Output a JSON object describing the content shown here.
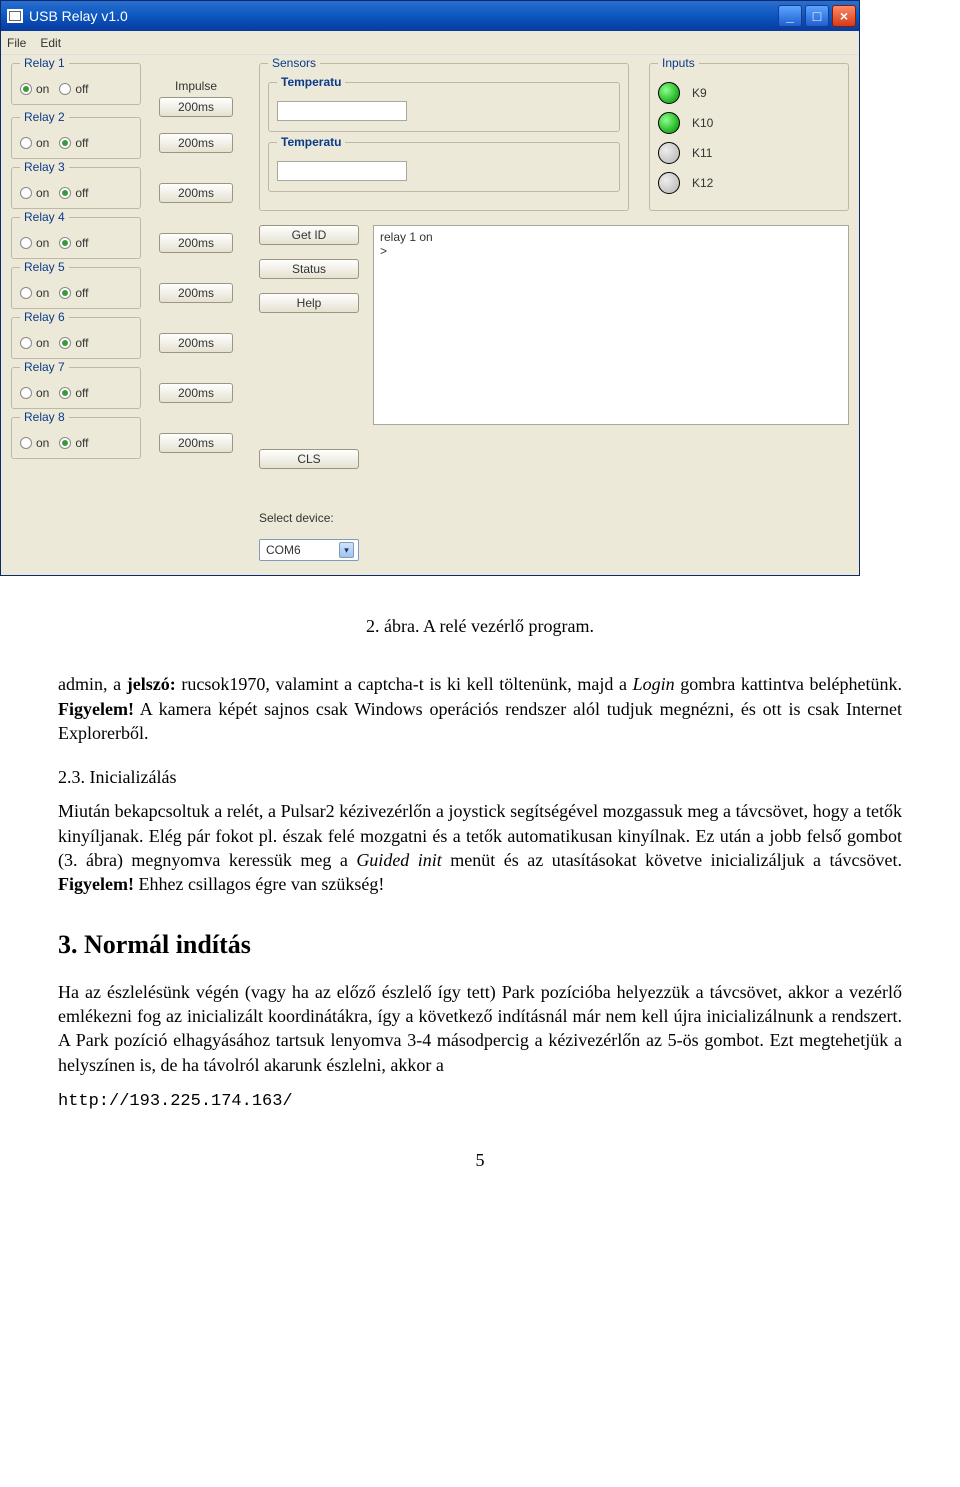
{
  "window": {
    "title": "USB Relay  v1.0",
    "menus": [
      "File",
      "Edit"
    ],
    "win_buttons": {
      "min": "_",
      "max": "□",
      "close": "×"
    }
  },
  "relays": [
    {
      "name": "Relay 1",
      "on": true,
      "off": false,
      "impulse": "200ms"
    },
    {
      "name": "Relay 2",
      "on": false,
      "off": true,
      "impulse": "200ms"
    },
    {
      "name": "Relay 3",
      "on": false,
      "off": true,
      "impulse": "200ms"
    },
    {
      "name": "Relay 4",
      "on": false,
      "off": true,
      "impulse": "200ms"
    },
    {
      "name": "Relay 5",
      "on": false,
      "off": true,
      "impulse": "200ms"
    },
    {
      "name": "Relay 6",
      "on": false,
      "off": true,
      "impulse": "200ms"
    },
    {
      "name": "Relay 7",
      "on": false,
      "off": true,
      "impulse": "200ms"
    },
    {
      "name": "Relay 8",
      "on": false,
      "off": true,
      "impulse": "200ms"
    }
  ],
  "impulse_header": "Impulse",
  "radio_labels": {
    "on": "on",
    "off": "off"
  },
  "sensors": {
    "legend": "Sensors",
    "items": [
      {
        "title": "Temperatu",
        "value": ""
      },
      {
        "title": "Temperatu",
        "value": ""
      }
    ]
  },
  "inputs": {
    "legend": "Inputs",
    "items": [
      {
        "label": "K9",
        "on": true
      },
      {
        "label": "K10",
        "on": true
      },
      {
        "label": "K11",
        "on": false
      },
      {
        "label": "K12",
        "on": false
      }
    ]
  },
  "mid_buttons": {
    "get_id": "Get ID",
    "status": "Status",
    "help": "Help",
    "cls": "CLS"
  },
  "textarea": "relay 1 on\n>",
  "select": {
    "label": "Select device:",
    "value": "COM6"
  },
  "doc": {
    "caption": "2. ábra. A relé vezérlő program.",
    "p1_a": "admin, a ",
    "p1_b": "jelszó:",
    "p1_c": " rucsok1970, valamint a captcha-t is ki kell töltenünk, majd a ",
    "p1_d": "Login",
    "p1_e": " gombra kattintva beléphetünk. ",
    "p1_f": "Figyelem!",
    "p1_g": " A kamera képét sajnos csak Windows operációs rendszer alól tudjuk megnézni, és ott is csak Internet Explorerből.",
    "sec23_num": "2.3.",
    "sec23_title": "    Inicializálás",
    "p2_a": "Miután bekapcsoltuk a relét, a Pulsar2 kézivezérlőn a joystick segítségével mozgassuk meg a távcsövet, hogy a tetők kinyíljanak. Elég pár fokot pl. észak felé mozgatni és a tetők automatikusan kinyílnak. Ez után a jobb felső gombot (3. ábra) megnyomva keressük meg a ",
    "p2_b": "Guided init",
    "p2_c": " menüt és az utasításokat követve inicializáljuk a távcsövet. ",
    "p2_d": "Figyelem!",
    "p2_e": " Ehhez csillagos égre van szükség!",
    "h2_num": "3.",
    "h2_title": "    Normál indítás",
    "p3": "Ha az észlelésünk végén (vagy ha az előző észlelő így tett) Park pozícióba helyezzük a távcsövet, akkor a vezérlő emlékezni fog az inicializált koordinátákra, így a következő indításnál már nem kell újra inicializálnunk a rendszert. A Park pozíció elhagyásához tartsuk lenyomva 3-4 másodpercig a kézivezérlőn az 5-ös gombot. Ezt megtehetjük a helyszínen is, de ha távolról akarunk észlelni, akkor a",
    "url": "http://193.225.174.163/",
    "page": "5"
  }
}
